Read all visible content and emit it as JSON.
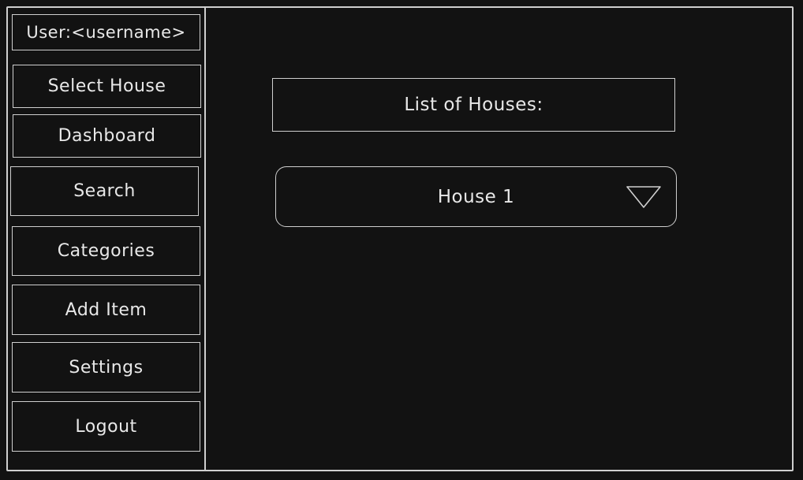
{
  "user": {
    "label": "User:<username>"
  },
  "sidebar": {
    "items": [
      {
        "label": "Select House"
      },
      {
        "label": "Dashboard"
      },
      {
        "label": "Search"
      },
      {
        "label": "Categories"
      },
      {
        "label": "Add Item"
      },
      {
        "label": "Settings"
      },
      {
        "label": "Logout"
      }
    ]
  },
  "main": {
    "list_title": "List of Houses:",
    "house_select": {
      "selected": "House 1",
      "icon": "triangle-down-icon"
    }
  },
  "colors": {
    "background": "#121212",
    "stroke": "#cfcfcf",
    "text": "#e8e8e8"
  }
}
